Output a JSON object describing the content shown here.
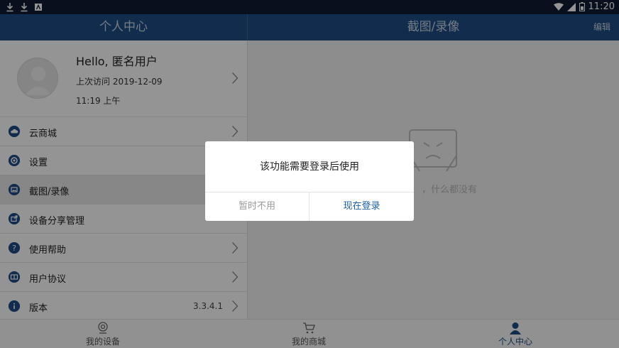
{
  "colors": {
    "status_bar": "#0e1d33",
    "header": "#1e4d83",
    "accent": "#1e4d83",
    "link": "#1e5fa8"
  },
  "status_bar": {
    "time": "11:20",
    "icons": [
      "download-icon",
      "download-icon",
      "notification-icon",
      "wifi-icon",
      "signal-icon",
      "battery-icon"
    ]
  },
  "header": {
    "left_title": "个人中心",
    "right_title": "截图/录像",
    "edit_label": "编辑"
  },
  "profile": {
    "greeting": "Hello, 匿名用户",
    "last_visit": "上次访问 2019-12-09",
    "last_visit_time": "11:19 上午"
  },
  "menu": {
    "items": [
      {
        "label": "云商城",
        "icon": "cloud-icon"
      },
      {
        "label": "设置",
        "icon": "settings-icon"
      },
      {
        "label": "截图/录像",
        "icon": "image-icon"
      },
      {
        "label": "设备分享管理",
        "icon": "share-icon"
      },
      {
        "label": "使用帮助",
        "icon": "help-icon"
      },
      {
        "label": "用户协议",
        "icon": "book-icon"
      },
      {
        "label": "版本",
        "icon": "info-icon",
        "value": "3.3.4.1"
      }
    ]
  },
  "empty_state": {
    "text": "，什么都没有"
  },
  "dialog": {
    "message": "该功能需要登录后使用",
    "cancel_label": "暂时不用",
    "confirm_label": "现在登录"
  },
  "bottom_nav": {
    "tabs": [
      {
        "label": "我的设备"
      },
      {
        "label": "我的商城"
      },
      {
        "label": "个人中心"
      }
    ]
  }
}
